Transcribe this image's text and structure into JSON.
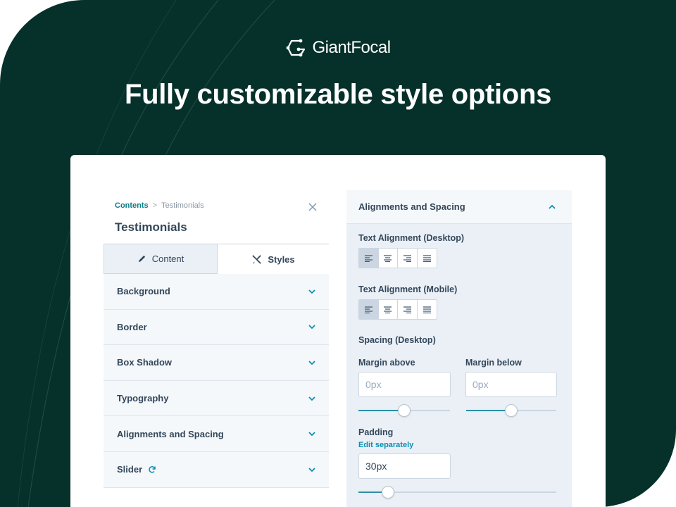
{
  "brand": {
    "name": "GiantFocal"
  },
  "headline": "Fully customizable style options",
  "colors": {
    "background": "#06302a",
    "accent": "#0a7d87",
    "panel": "#eaf0f6"
  },
  "left_panel": {
    "breadcrumb": {
      "parent": "Contents",
      "separator": ">",
      "current": "Testimonials"
    },
    "title": "Testimonials",
    "tabs": [
      {
        "label": "Content",
        "icon": "pencil-icon",
        "active": false
      },
      {
        "label": "Styles",
        "icon": "scissors-brush-icon",
        "active": true
      }
    ],
    "sections": [
      {
        "label": "Background"
      },
      {
        "label": "Border"
      },
      {
        "label": "Box Shadow"
      },
      {
        "label": "Typography"
      },
      {
        "label": "Alignments and Spacing"
      },
      {
        "label": "Slider",
        "icon": "refresh-icon"
      }
    ]
  },
  "right_panel": {
    "header": "Alignments and Spacing",
    "text_alignment_desktop": {
      "label": "Text Alignment (Desktop)",
      "selected": "left"
    },
    "text_alignment_mobile": {
      "label": "Text Alignment (Mobile)",
      "selected": "left"
    },
    "spacing_desktop": {
      "label": "Spacing (Desktop)",
      "margin_above": {
        "label": "Margin above",
        "placeholder": "0px",
        "slider_value": 0.5
      },
      "margin_below": {
        "label": "Margin below",
        "placeholder": "0px",
        "slider_value": 0.5
      }
    },
    "padding": {
      "label": "Padding",
      "edit_link": "Edit separately",
      "value": "30px",
      "slider_value": 0.15
    }
  }
}
